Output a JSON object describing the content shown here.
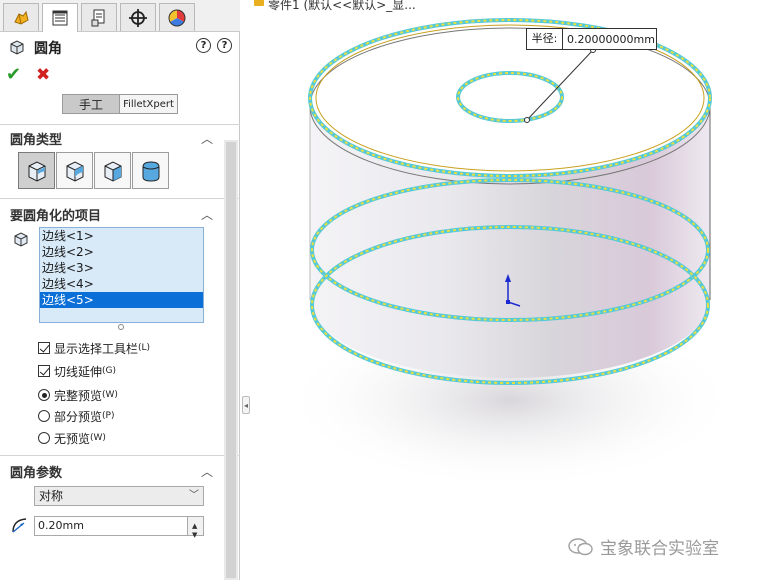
{
  "tabs": [
    {
      "name": "feature-manager"
    },
    {
      "name": "property-manager"
    },
    {
      "name": "configuration-manager"
    },
    {
      "name": "dimxpert-manager"
    },
    {
      "name": "display-manager"
    }
  ],
  "panel": {
    "title": "圆角",
    "mode_tabs": {
      "manual": "手工",
      "filletxpert": "FilletXpert"
    },
    "fillet_type": {
      "header": "圆角类型",
      "types": [
        "constant-size-fillet",
        "variable-size-fillet",
        "face-fillet",
        "full-round-fillet"
      ],
      "selected_index": 0
    },
    "items": {
      "header": "要圆角化的项目",
      "edges": [
        "边线<1>",
        "边线<2>",
        "边线<3>",
        "边线<4>",
        "边线<5>"
      ],
      "selected_index": 4,
      "show_selection_toolbar": {
        "label": "显示选择工具栏",
        "key": "(L)",
        "checked": true
      },
      "tangent_propagation": {
        "label": "切线延伸",
        "key": "(G)",
        "checked": true
      },
      "preview_full": {
        "label": "完整预览",
        "key": "(W)",
        "selected": true
      },
      "preview_partial": {
        "label": "部分预览",
        "key": "(P)",
        "selected": false
      },
      "preview_none": {
        "label": "无预览",
        "key": "(W)",
        "selected": false
      }
    },
    "parameters": {
      "header": "圆角参数",
      "method": "对称",
      "radius": "0.20mm"
    }
  },
  "viewport": {
    "breadcrumb": "零件1 (默认<<默认>_显...",
    "radius_callout": {
      "label": "半径:",
      "value": "0.20000000mm"
    }
  },
  "watermark": "宝象联合实验室",
  "colors": {
    "selection_blue": "#0a6fd6",
    "list_bg": "#d8e9f8",
    "edge_highlight": "#55c9d8",
    "edge_yellow": "#e8e040",
    "ok_green": "#2a9a2a",
    "cancel_red": "#d02020"
  }
}
